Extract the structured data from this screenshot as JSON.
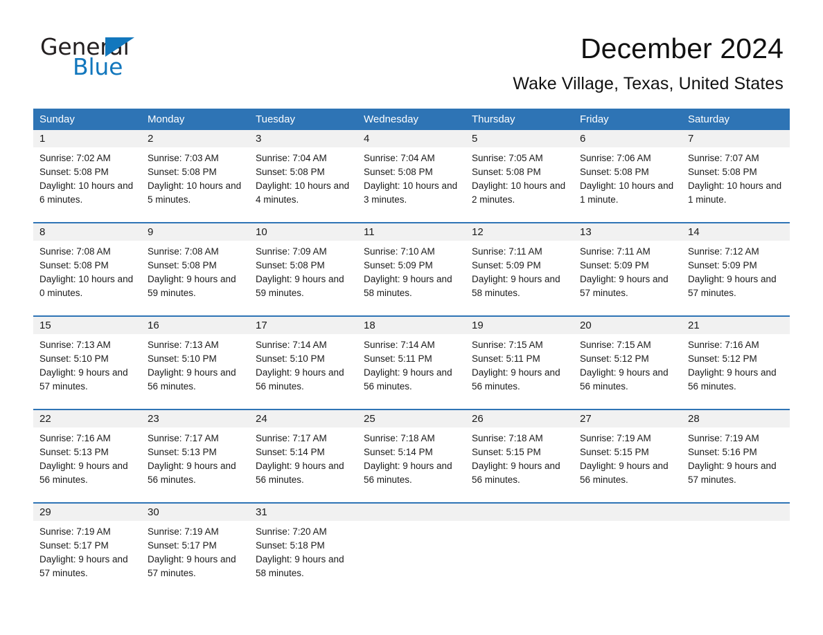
{
  "logo": {
    "word_general": "General",
    "word_blue": "Blue",
    "triangle_color": "#1277bd"
  },
  "header": {
    "title": "December 2024",
    "subtitle": "Wake Village, Texas, United States"
  },
  "colors": {
    "header_blue": "#2e74b5",
    "day_strip_gray": "#f1f1f1",
    "text": "#1a1a1a"
  },
  "weekdays": [
    "Sunday",
    "Monday",
    "Tuesday",
    "Wednesday",
    "Thursday",
    "Friday",
    "Saturday"
  ],
  "labels": {
    "sunrise_prefix": "Sunrise:",
    "sunset_prefix": "Sunset:",
    "daylight_prefix": "Daylight:"
  },
  "weeks": [
    [
      {
        "day": "1",
        "sunrise": "Sunrise: 7:02 AM",
        "sunset": "Sunset: 5:08 PM",
        "daylight": "Daylight: 10 hours and 6 minutes."
      },
      {
        "day": "2",
        "sunrise": "Sunrise: 7:03 AM",
        "sunset": "Sunset: 5:08 PM",
        "daylight": "Daylight: 10 hours and 5 minutes."
      },
      {
        "day": "3",
        "sunrise": "Sunrise: 7:04 AM",
        "sunset": "Sunset: 5:08 PM",
        "daylight": "Daylight: 10 hours and 4 minutes."
      },
      {
        "day": "4",
        "sunrise": "Sunrise: 7:04 AM",
        "sunset": "Sunset: 5:08 PM",
        "daylight": "Daylight: 10 hours and 3 minutes."
      },
      {
        "day": "5",
        "sunrise": "Sunrise: 7:05 AM",
        "sunset": "Sunset: 5:08 PM",
        "daylight": "Daylight: 10 hours and 2 minutes."
      },
      {
        "day": "6",
        "sunrise": "Sunrise: 7:06 AM",
        "sunset": "Sunset: 5:08 PM",
        "daylight": "Daylight: 10 hours and 1 minute."
      },
      {
        "day": "7",
        "sunrise": "Sunrise: 7:07 AM",
        "sunset": "Sunset: 5:08 PM",
        "daylight": "Daylight: 10 hours and 1 minute."
      }
    ],
    [
      {
        "day": "8",
        "sunrise": "Sunrise: 7:08 AM",
        "sunset": "Sunset: 5:08 PM",
        "daylight": "Daylight: 10 hours and 0 minutes."
      },
      {
        "day": "9",
        "sunrise": "Sunrise: 7:08 AM",
        "sunset": "Sunset: 5:08 PM",
        "daylight": "Daylight: 9 hours and 59 minutes."
      },
      {
        "day": "10",
        "sunrise": "Sunrise: 7:09 AM",
        "sunset": "Sunset: 5:08 PM",
        "daylight": "Daylight: 9 hours and 59 minutes."
      },
      {
        "day": "11",
        "sunrise": "Sunrise: 7:10 AM",
        "sunset": "Sunset: 5:09 PM",
        "daylight": "Daylight: 9 hours and 58 minutes."
      },
      {
        "day": "12",
        "sunrise": "Sunrise: 7:11 AM",
        "sunset": "Sunset: 5:09 PM",
        "daylight": "Daylight: 9 hours and 58 minutes."
      },
      {
        "day": "13",
        "sunrise": "Sunrise: 7:11 AM",
        "sunset": "Sunset: 5:09 PM",
        "daylight": "Daylight: 9 hours and 57 minutes."
      },
      {
        "day": "14",
        "sunrise": "Sunrise: 7:12 AM",
        "sunset": "Sunset: 5:09 PM",
        "daylight": "Daylight: 9 hours and 57 minutes."
      }
    ],
    [
      {
        "day": "15",
        "sunrise": "Sunrise: 7:13 AM",
        "sunset": "Sunset: 5:10 PM",
        "daylight": "Daylight: 9 hours and 57 minutes."
      },
      {
        "day": "16",
        "sunrise": "Sunrise: 7:13 AM",
        "sunset": "Sunset: 5:10 PM",
        "daylight": "Daylight: 9 hours and 56 minutes."
      },
      {
        "day": "17",
        "sunrise": "Sunrise: 7:14 AM",
        "sunset": "Sunset: 5:10 PM",
        "daylight": "Daylight: 9 hours and 56 minutes."
      },
      {
        "day": "18",
        "sunrise": "Sunrise: 7:14 AM",
        "sunset": "Sunset: 5:11 PM",
        "daylight": "Daylight: 9 hours and 56 minutes."
      },
      {
        "day": "19",
        "sunrise": "Sunrise: 7:15 AM",
        "sunset": "Sunset: 5:11 PM",
        "daylight": "Daylight: 9 hours and 56 minutes."
      },
      {
        "day": "20",
        "sunrise": "Sunrise: 7:15 AM",
        "sunset": "Sunset: 5:12 PM",
        "daylight": "Daylight: 9 hours and 56 minutes."
      },
      {
        "day": "21",
        "sunrise": "Sunrise: 7:16 AM",
        "sunset": "Sunset: 5:12 PM",
        "daylight": "Daylight: 9 hours and 56 minutes."
      }
    ],
    [
      {
        "day": "22",
        "sunrise": "Sunrise: 7:16 AM",
        "sunset": "Sunset: 5:13 PM",
        "daylight": "Daylight: 9 hours and 56 minutes."
      },
      {
        "day": "23",
        "sunrise": "Sunrise: 7:17 AM",
        "sunset": "Sunset: 5:13 PM",
        "daylight": "Daylight: 9 hours and 56 minutes."
      },
      {
        "day": "24",
        "sunrise": "Sunrise: 7:17 AM",
        "sunset": "Sunset: 5:14 PM",
        "daylight": "Daylight: 9 hours and 56 minutes."
      },
      {
        "day": "25",
        "sunrise": "Sunrise: 7:18 AM",
        "sunset": "Sunset: 5:14 PM",
        "daylight": "Daylight: 9 hours and 56 minutes."
      },
      {
        "day": "26",
        "sunrise": "Sunrise: 7:18 AM",
        "sunset": "Sunset: 5:15 PM",
        "daylight": "Daylight: 9 hours and 56 minutes."
      },
      {
        "day": "27",
        "sunrise": "Sunrise: 7:19 AM",
        "sunset": "Sunset: 5:15 PM",
        "daylight": "Daylight: 9 hours and 56 minutes."
      },
      {
        "day": "28",
        "sunrise": "Sunrise: 7:19 AM",
        "sunset": "Sunset: 5:16 PM",
        "daylight": "Daylight: 9 hours and 57 minutes."
      }
    ],
    [
      {
        "day": "29",
        "sunrise": "Sunrise: 7:19 AM",
        "sunset": "Sunset: 5:17 PM",
        "daylight": "Daylight: 9 hours and 57 minutes."
      },
      {
        "day": "30",
        "sunrise": "Sunrise: 7:19 AM",
        "sunset": "Sunset: 5:17 PM",
        "daylight": "Daylight: 9 hours and 57 minutes."
      },
      {
        "day": "31",
        "sunrise": "Sunrise: 7:20 AM",
        "sunset": "Sunset: 5:18 PM",
        "daylight": "Daylight: 9 hours and 58 minutes."
      },
      {
        "day": "",
        "sunrise": "",
        "sunset": "",
        "daylight": ""
      },
      {
        "day": "",
        "sunrise": "",
        "sunset": "",
        "daylight": ""
      },
      {
        "day": "",
        "sunrise": "",
        "sunset": "",
        "daylight": ""
      },
      {
        "day": "",
        "sunrise": "",
        "sunset": "",
        "daylight": ""
      }
    ]
  ]
}
